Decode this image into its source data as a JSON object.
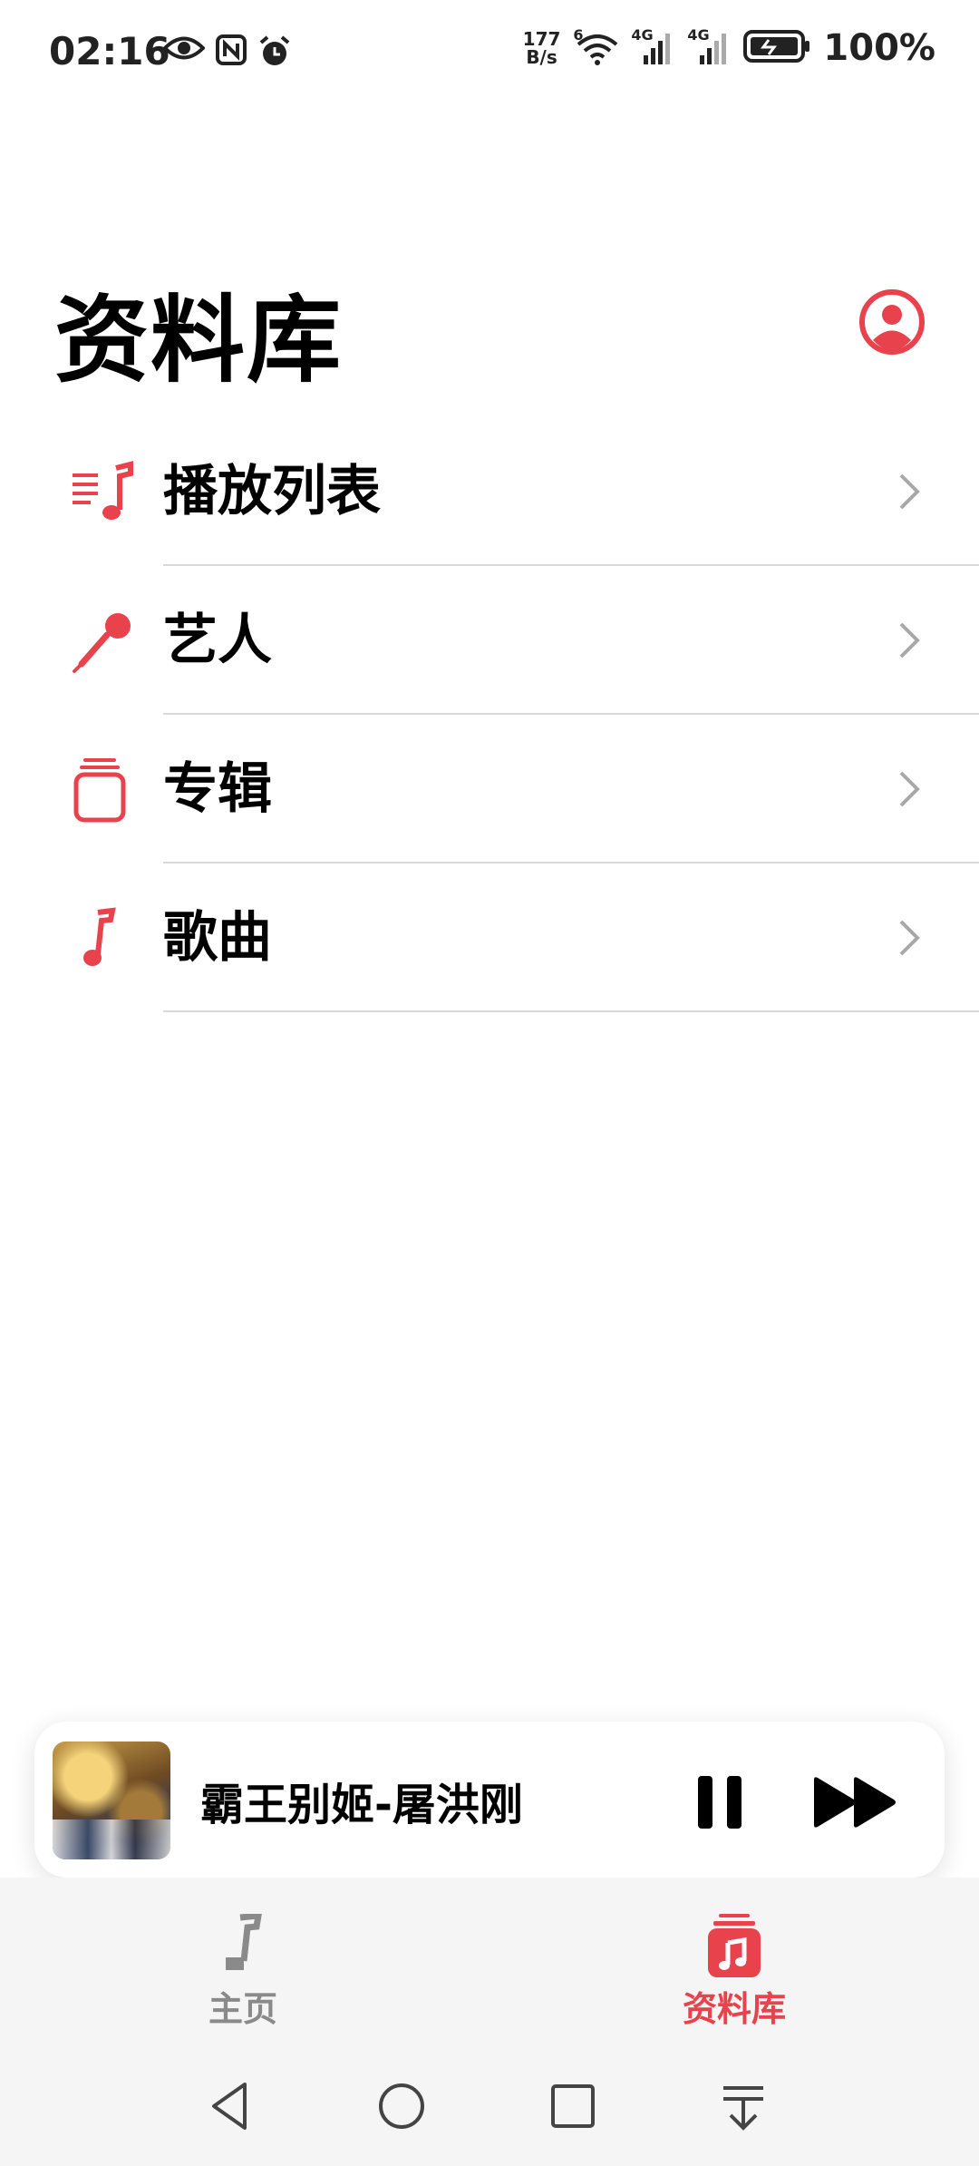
{
  "status_bar": {
    "time": "02:16",
    "left_icons": [
      "eye-icon",
      "nfc-icon",
      "alarm-icon"
    ],
    "net_speed_value": "177",
    "net_speed_unit": "B/s",
    "wifi_label": "6",
    "signal1_label": "4G",
    "signal2_label": "4G",
    "battery": "100%"
  },
  "header": {
    "title": "资料库",
    "account_icon": "account-circle-icon"
  },
  "menu": {
    "items": [
      {
        "label": "播放列表",
        "icon": "playlist-icon"
      },
      {
        "label": "艺人",
        "icon": "microphone-icon"
      },
      {
        "label": "专辑",
        "icon": "album-stack-icon"
      },
      {
        "label": "歌曲",
        "icon": "music-note-icon"
      }
    ]
  },
  "mini_player": {
    "track": "霸王别姬-屠洪刚",
    "state": "playing"
  },
  "tab_bar": {
    "tabs": [
      {
        "label": "主页",
        "icon": "music-note-icon",
        "active": false
      },
      {
        "label": "资料库",
        "icon": "library-icon",
        "active": true
      }
    ]
  },
  "colors": {
    "accent": "#e8424c",
    "inactive": "#8a8a8a",
    "divider": "#d9d9d9"
  },
  "system_nav": [
    "back-icon",
    "home-icon",
    "recents-icon",
    "notification-pull-icon"
  ]
}
